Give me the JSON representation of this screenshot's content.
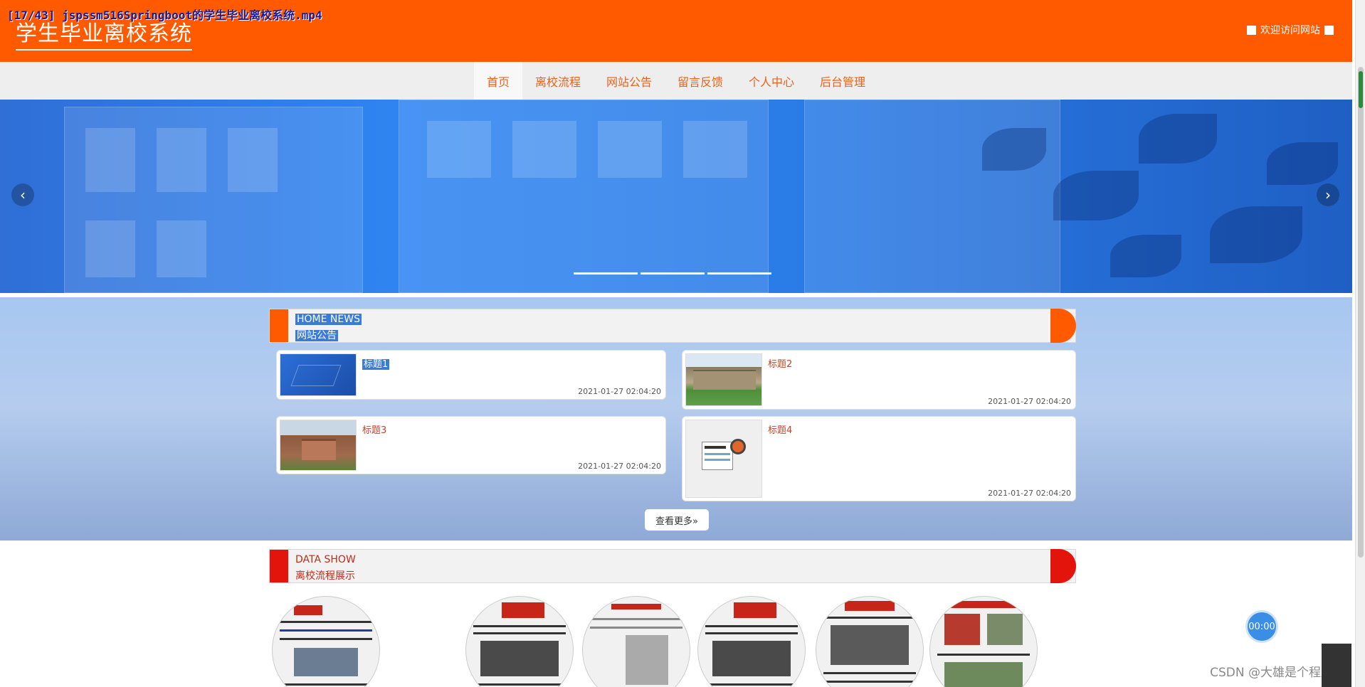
{
  "overlay": {
    "video_caption": "[17/43] jspssm516Springboot的学生毕业离校系统.mp4"
  },
  "header": {
    "site_title": "学生毕业离校系统",
    "welcome": "欢迎访问网站",
    "bg_color": "#ff5a00"
  },
  "nav": {
    "items": [
      {
        "label": "首页",
        "active": true
      },
      {
        "label": "离校流程",
        "active": false
      },
      {
        "label": "网站公告",
        "active": false
      },
      {
        "label": "留言反馈",
        "active": false
      },
      {
        "label": "个人中心",
        "active": false
      },
      {
        "label": "后台管理",
        "active": false
      }
    ],
    "text_color": "#e8621a"
  },
  "banner": {
    "prev_icon": "chevron-left-icon",
    "next_icon": "chevron-right-icon",
    "slide_count": 3
  },
  "news": {
    "en_title": "HOME NEWS",
    "cn_title": "网站公告",
    "accent_color": "#ff5a00",
    "items": [
      {
        "title": "标题1",
        "date": "2021-01-27 02:04:20"
      },
      {
        "title": "标题2",
        "date": "2021-01-27 02:04:20"
      },
      {
        "title": "标题3",
        "date": "2021-01-27 02:04:20"
      },
      {
        "title": "标题4",
        "date": "2021-01-27 02:04:20"
      }
    ],
    "more_label": "查看更多»"
  },
  "datashow": {
    "en_title": "DATA SHOW",
    "cn_title": "离校流程展示",
    "accent_color": "#e2140c",
    "circle_count": 6
  },
  "timer": {
    "label": "00:00"
  },
  "watermark": "CSDN @大雄是个程序员"
}
